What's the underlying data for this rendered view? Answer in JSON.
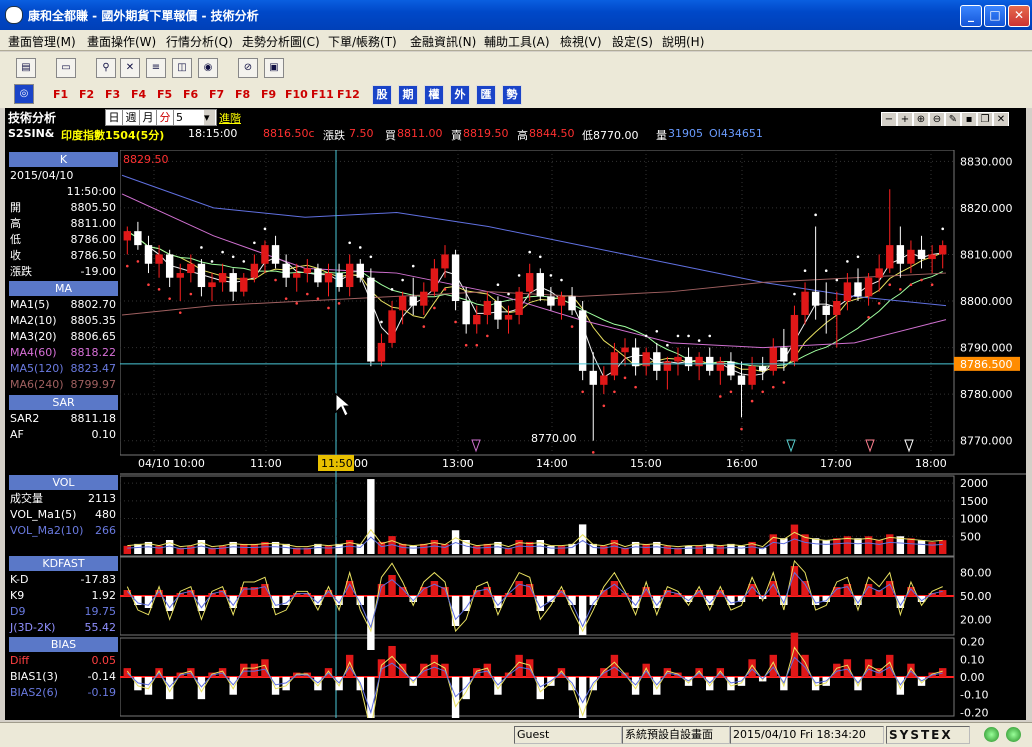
{
  "window": {
    "title": "康和全都賺 - 國外期貨下單報價 - 技術分析",
    "min": "_",
    "max": "□",
    "close": "✕"
  },
  "menu": [
    "畫面管理(M)",
    "畫面操作(W)",
    "行情分析(Q)",
    "走勢分析圖(C)",
    "下單/帳務(T)",
    "金融資訊(N)",
    "輔助工具(A)",
    "檢視(V)",
    "設定(S)",
    "說明(H)"
  ],
  "fkeys": [
    "F1",
    "F2",
    "F3",
    "F4",
    "F5",
    "F6",
    "F7",
    "F8",
    "F9",
    "F10",
    "F11",
    "F12"
  ],
  "blocks": [
    "股",
    "期",
    "權",
    "外",
    "匯",
    "勢"
  ],
  "header": {
    "title": "技術分析",
    "periods": [
      "日",
      "週",
      "月",
      "分"
    ],
    "interval": "5",
    "advanced": "進階"
  },
  "quote": {
    "symbol": "S2SIN&",
    "name": "印度指數1504(5分)",
    "time": "18:15:00",
    "last": "8816.50c",
    "change_label": "漲跌",
    "change": "7.50",
    "bid_label": "買",
    "bid": "8811.00",
    "ask_label": "賣",
    "ask": "8819.50",
    "high_label": "高",
    "high": "8844.50",
    "low": "低8770.00",
    "vol_label": "量",
    "vol": "31905",
    "oi": "OI434651"
  },
  "left": {
    "k": {
      "head": "K",
      "date": "2015/04/10",
      "time": "11:50:00",
      "rows": [
        [
          "開",
          "8805.50"
        ],
        [
          "高",
          "8811.00"
        ],
        [
          "低",
          "8786.00"
        ],
        [
          "收",
          "8786.50"
        ],
        [
          "漲跌",
          "-19.00"
        ]
      ]
    },
    "ma": {
      "head": "MA",
      "rows": [
        [
          "MA1(5)",
          "8802.70",
          "#ffffff"
        ],
        [
          "MA2(10)",
          "8805.35",
          "#ffffff"
        ],
        [
          "MA3(20)",
          "8806.65",
          "#ffffff"
        ],
        [
          "MA4(60)",
          "8818.22",
          "#d870d8"
        ],
        [
          "MA5(120)",
          "8823.47",
          "#6a7ae0"
        ],
        [
          "MA6(240)",
          "8799.97",
          "#a06060"
        ]
      ]
    },
    "sar": {
      "head": "SAR",
      "rows": [
        [
          "SAR2",
          "8811.18"
        ],
        [
          "AF",
          "0.10"
        ]
      ]
    },
    "vol": {
      "head": "VOL",
      "rows": [
        [
          "成交量",
          "2113",
          "#ffffff"
        ],
        [
          "VOL_Ma1(5)",
          "480",
          "#ffffff"
        ],
        [
          "VOL_Ma2(10)",
          "266",
          "#6a7ae0"
        ]
      ]
    },
    "kd": {
      "head": "KDFAST",
      "rows": [
        [
          "K-D",
          "-17.83",
          "#ffffff"
        ],
        [
          "K9",
          "1.92",
          "#ffffff"
        ],
        [
          "D9",
          "19.75",
          "#6a7ae0"
        ],
        [
          "J(3D-2K)",
          "55.42",
          "#9090ff"
        ]
      ]
    },
    "bias": {
      "head": "BIAS",
      "rows": [
        [
          "Diff",
          "0.05",
          "#ff4040"
        ],
        [
          "BIAS1(3)",
          "-0.14",
          "#ffffff"
        ],
        [
          "BIAS2(6)",
          "-0.19",
          "#6a7ae0"
        ]
      ]
    }
  },
  "chart_data": {
    "type": "candlestick",
    "main": {
      "top_label": "8829.50",
      "low_label": "8770.00",
      "yticks": [
        "8830.000",
        "8820.000",
        "8810.000",
        "8800.000",
        "8790.000",
        "8780.000",
        "8770.000"
      ],
      "ylim": [
        8768,
        8832
      ],
      "cursor_price": "8786.500",
      "cursor_time": "11:50",
      "xticks": [
        "04/10 10:00",
        "11:00",
        "00",
        "13:00",
        "14:00",
        "15:00",
        "16:00",
        "17:00",
        "18:00"
      ]
    },
    "candles": [
      [
        8813,
        8816,
        8810,
        8815
      ],
      [
        8815,
        8817,
        8811,
        8812
      ],
      [
        8812,
        8814,
        8806,
        8808
      ],
      [
        8808,
        8812,
        8805,
        8810
      ],
      [
        8810,
        8811,
        8803,
        8805
      ],
      [
        8805,
        8808,
        8800,
        8806
      ],
      [
        8806,
        8810,
        8804,
        8808
      ],
      [
        8808,
        8809,
        8801,
        8803
      ],
      [
        8803,
        8806,
        8800,
        8804
      ],
      [
        8804,
        8808,
        8802,
        8806
      ],
      [
        8806,
        8807,
        8800,
        8802
      ],
      [
        8802,
        8806,
        8801,
        8805
      ],
      [
        8805,
        8810,
        8804,
        8808
      ],
      [
        8808,
        8813,
        8806,
        8812
      ],
      [
        8812,
        8814,
        8807,
        8808
      ],
      [
        8808,
        8810,
        8803,
        8805
      ],
      [
        8805,
        8808,
        8802,
        8806
      ],
      [
        8806,
        8809,
        8804,
        8807
      ],
      [
        8807,
        8808,
        8803,
        8804
      ],
      [
        8804,
        8808,
        8801,
        8806
      ],
      [
        8806,
        8808,
        8802,
        8803
      ],
      [
        8803,
        8810,
        8801,
        8808
      ],
      [
        8808,
        8809,
        8804,
        8805
      ],
      [
        8805,
        8807,
        8786,
        8787
      ],
      [
        8787,
        8793,
        8786,
        8791
      ],
      [
        8791,
        8800,
        8790,
        8798
      ],
      [
        8798,
        8802,
        8795,
        8801
      ],
      [
        8801,
        8805,
        8797,
        8799
      ],
      [
        8799,
        8804,
        8797,
        8802
      ],
      [
        8802,
        8809,
        8801,
        8807
      ],
      [
        8807,
        8812,
        8805,
        8810
      ],
      [
        8810,
        8811,
        8798,
        8800
      ],
      [
        8800,
        8803,
        8793,
        8795
      ],
      [
        8795,
        8799,
        8793,
        8797
      ],
      [
        8797,
        8802,
        8795,
        8800
      ],
      [
        8800,
        8801,
        8794,
        8796
      ],
      [
        8796,
        8799,
        8793,
        8797
      ],
      [
        8797,
        8803,
        8795,
        8802
      ],
      [
        8802,
        8808,
        8800,
        8806
      ],
      [
        8806,
        8807,
        8800,
        8801
      ],
      [
        8801,
        8803,
        8798,
        8799
      ],
      [
        8799,
        8802,
        8796,
        8801
      ],
      [
        8801,
        8803,
        8797,
        8798
      ],
      [
        8798,
        8800,
        8783,
        8785
      ],
      [
        8785,
        8789,
        8770,
        8782
      ],
      [
        8782,
        8786,
        8780,
        8784
      ],
      [
        8784,
        8791,
        8783,
        8789
      ],
      [
        8789,
        8792,
        8786,
        8790
      ],
      [
        8790,
        8792,
        8784,
        8786
      ],
      [
        8786,
        8790,
        8784,
        8789
      ],
      [
        8789,
        8791,
        8783,
        8785
      ],
      [
        8785,
        8788,
        8781,
        8787
      ],
      [
        8787,
        8790,
        8784,
        8788
      ],
      [
        8788,
        8790,
        8785,
        8786
      ],
      [
        8786,
        8789,
        8783,
        8788
      ],
      [
        8788,
        8790,
        8784,
        8785
      ],
      [
        8785,
        8788,
        8782,
        8787
      ],
      [
        8787,
        8789,
        8783,
        8784
      ],
      [
        8784,
        8787,
        8775,
        8782
      ],
      [
        8782,
        8788,
        8781,
        8786
      ],
      [
        8786,
        8788,
        8783,
        8785
      ],
      [
        8785,
        8792,
        8784,
        8790
      ],
      [
        8790,
        8794,
        8785,
        8787
      ],
      [
        8787,
        8799,
        8786,
        8797
      ],
      [
        8797,
        8804,
        8795,
        8802
      ],
      [
        8802,
        8816,
        8796,
        8799
      ],
      [
        8799,
        8804,
        8793,
        8797
      ],
      [
        8797,
        8802,
        8790,
        8800
      ],
      [
        8800,
        8806,
        8798,
        8804
      ],
      [
        8804,
        8807,
        8800,
        8801
      ],
      [
        8801,
        8806,
        8799,
        8805
      ],
      [
        8805,
        8810,
        8802,
        8807
      ],
      [
        8807,
        8824,
        8806,
        8812
      ],
      [
        8812,
        8816,
        8805,
        8808
      ],
      [
        8808,
        8813,
        8806,
        8811
      ],
      [
        8811,
        8814,
        8807,
        8809
      ],
      [
        8809,
        8812,
        8806,
        8810
      ],
      [
        8810,
        8813,
        8807,
        8812
      ]
    ],
    "volume": {
      "yticks": [
        "2000",
        "1500",
        "1000",
        "500"
      ],
      "ylim": [
        0,
        2200
      ]
    },
    "kd": {
      "yticks": [
        "80.00",
        "50.00",
        "20.00"
      ],
      "ylim": [
        0,
        100
      ]
    },
    "bias": {
      "yticks": [
        "0.20",
        "0.10",
        "0.00",
        "-0.10",
        "-0.20"
      ],
      "ylim": [
        -0.22,
        0.22
      ]
    }
  },
  "status": {
    "user": "Guest",
    "layout": "系統預設自設畫面",
    "datetime": "2015/04/10 Fri 18:34:20",
    "brand": "SYSTEX"
  }
}
